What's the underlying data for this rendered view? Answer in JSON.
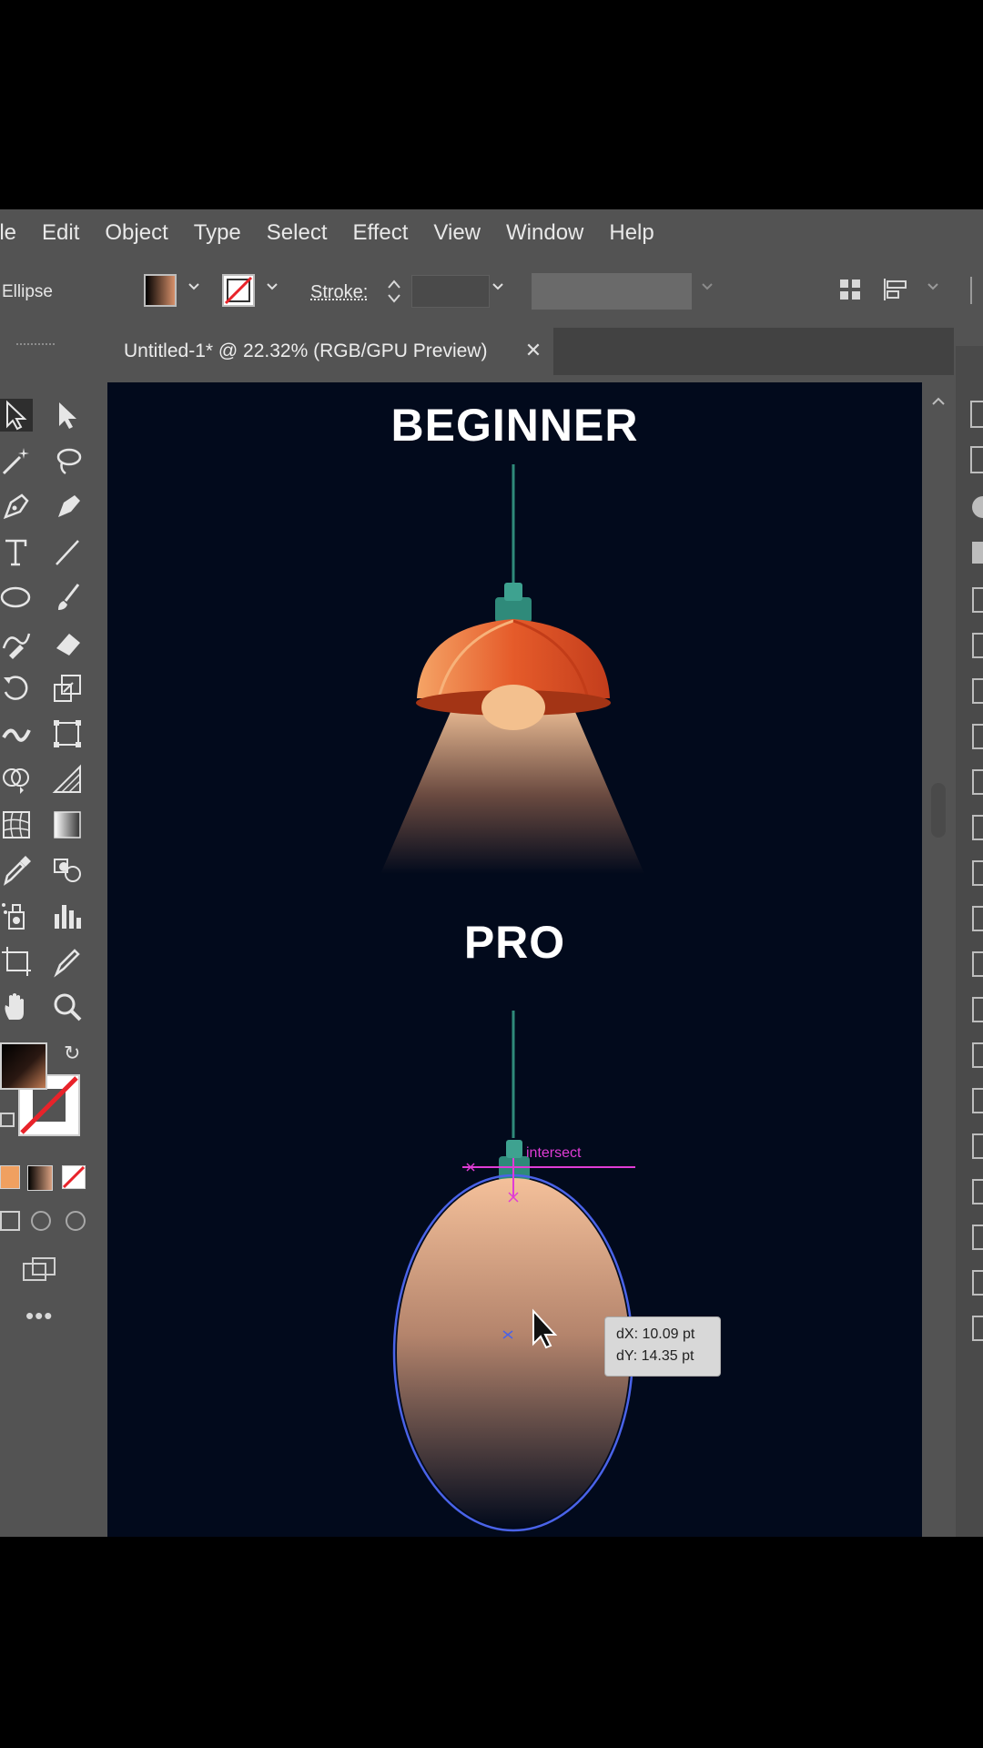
{
  "menubar": {
    "items": [
      "ile",
      "Edit",
      "Object",
      "Type",
      "Select",
      "Effect",
      "View",
      "Window",
      "Help"
    ]
  },
  "controlbar": {
    "selection_label": "Ellipse",
    "stroke_label": "Stroke:",
    "fill": {
      "gradient_from": "#000000",
      "gradient_to": "#d7906a"
    }
  },
  "document_tab": {
    "title": "Untitled-1* @ 22.32% (RGB/GPU Preview)",
    "close_icon": "close-icon"
  },
  "toolbox": {
    "tools": [
      "selection-tool",
      "direct-selection-tool",
      "magic-wand-tool",
      "lasso-tool",
      "pen-tool",
      "curvature-tool",
      "type-tool",
      "line-tool",
      "ellipse-tool",
      "paintbrush-tool",
      "shaper-tool",
      "eraser-tool",
      "rotate-tool",
      "scale-tool",
      "width-tool",
      "free-transform-tool",
      "shape-builder-tool",
      "perspective-grid-tool",
      "mesh-tool",
      "gradient-tool",
      "eyedropper-tool",
      "blend-tool",
      "symbol-sprayer-tool",
      "column-graph-tool",
      "artboard-tool",
      "slice-tool",
      "hand-tool",
      "zoom-tool"
    ]
  },
  "canvas": {
    "background": "#020a1c",
    "heading_top": "BEGINNER",
    "heading_bottom": "PRO",
    "lamp_colors": {
      "shade": "#e3572a",
      "shade_light": "#f29a5e",
      "cap": "#2f8a7a",
      "bulb": "#f3c08e"
    },
    "smart_guide_label": "intersect",
    "measure": {
      "dx": "dX: 10.09 pt",
      "dy": "dY: 14.35 pt"
    },
    "selection_color": "#4a63e8"
  }
}
